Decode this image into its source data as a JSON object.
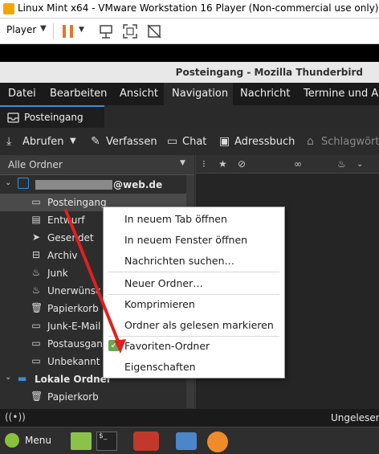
{
  "vmware": {
    "title": "Linux Mint x64 - VMware Workstation 16 Player (Non-commercial use only)",
    "player_label": "Player"
  },
  "thunderbird": {
    "window_title": "Posteingang - Mozilla Thunderbird",
    "menu": [
      "Datei",
      "Bearbeiten",
      "Ansicht",
      "Navigation",
      "Nachricht",
      "Termine und Au"
    ],
    "tab_label": "Posteingang",
    "toolbar": {
      "get_mail": "Abrufen",
      "write": "Verfassen",
      "chat": "Chat",
      "address_book": "Adressbuch",
      "tags": "Schlagwörte"
    },
    "folder_header": "Alle Ordner",
    "account_suffix": "@web.de",
    "folders": [
      {
        "name": "Posteingang",
        "icon": "inbox-icon",
        "selected": true
      },
      {
        "name": "Entwurf",
        "icon": "draft-icon"
      },
      {
        "name": "Gesendet",
        "icon": "sent-icon"
      },
      {
        "name": "Archiv",
        "icon": "archive-icon"
      },
      {
        "name": "Junk",
        "icon": "junk-icon"
      },
      {
        "name": "Unerwünsc",
        "icon": "junk-icon"
      },
      {
        "name": "Papierkorb",
        "icon": "trash-icon"
      },
      {
        "name": "Junk-E-Mail",
        "icon": "folder-icon"
      },
      {
        "name": "Postausgan",
        "icon": "folder-icon"
      },
      {
        "name": "Unbekannt",
        "icon": "folder-icon"
      }
    ],
    "local_folders": "Lokale Ordner",
    "local_items": [
      {
        "name": "Papierkorb",
        "icon": "trash-icon"
      }
    ],
    "status_text": "Ungelesen",
    "taskbar_menu": "Menu"
  },
  "context_menu": {
    "items": [
      {
        "label": "In neuem Tab öffnen"
      },
      {
        "label": "In neuem Fenster öffnen"
      },
      {
        "label": "Nachrichten suchen…"
      },
      {
        "label": "Neuer Ordner…"
      },
      {
        "label": "Komprimieren"
      },
      {
        "label": "Ordner als gelesen markieren"
      },
      {
        "label": "Favoriten-Ordner",
        "checked": true
      },
      {
        "label": "Eigenschaften"
      }
    ]
  },
  "colors": {
    "accent": "#3a8fd8",
    "annotation_arrow": "#e02020",
    "checkbox": "#6aa84f"
  }
}
